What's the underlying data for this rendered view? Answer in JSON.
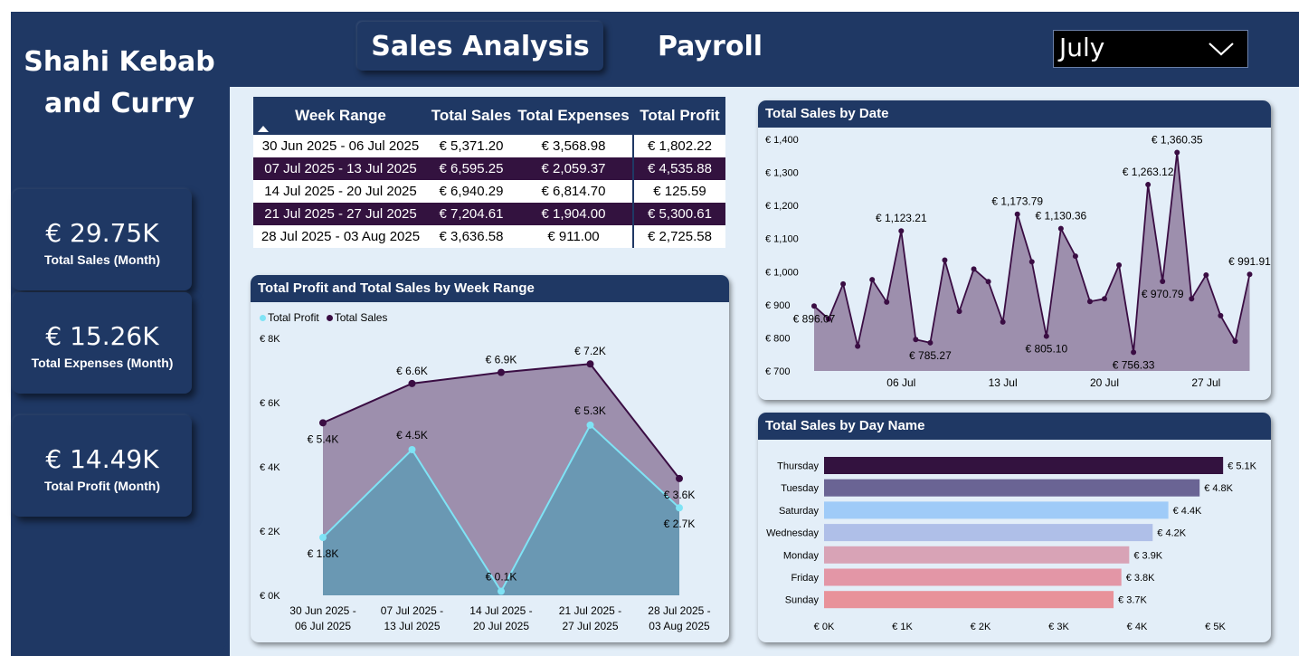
{
  "brand": {
    "line1": "Shahi Kebab",
    "line2": "and Curry"
  },
  "nav": {
    "active": "Sales Analysis",
    "inactive": "Payroll"
  },
  "month_filter": {
    "selected": "July"
  },
  "kpis": [
    {
      "value": "€ 29.75K",
      "label": "Total Sales (Month)"
    },
    {
      "value": "€ 15.26K",
      "label": "Total Expenses (Month)"
    },
    {
      "value": "€ 14.49K",
      "label": "Total Profit (Month)"
    }
  ],
  "week_table": {
    "headers": [
      "Week Range",
      "Total Sales",
      "Total Expenses",
      "Total Profit"
    ],
    "rows": [
      [
        "30 Jun 2025 - 06 Jul 2025",
        "€ 5,371.20",
        "€ 3,568.98",
        "€ 1,802.22"
      ],
      [
        "07 Jul 2025 - 13 Jul 2025",
        "€ 6,595.25",
        "€ 2,059.37",
        "€ 4,535.88"
      ],
      [
        "14 Jul 2025 - 20 Jul 2025",
        "€ 6,940.29",
        "€ 6,814.70",
        "€ 125.59"
      ],
      [
        "21 Jul 2025 - 27 Jul 2025",
        "€ 7,204.61",
        "€ 1,904.00",
        "€ 5,300.61"
      ],
      [
        "28 Jul 2025 - 03 Aug 2025",
        "€ 3,636.58",
        "€ 911.00",
        "€ 2,725.58"
      ]
    ]
  },
  "colors": {
    "navy": "#1f3864",
    "plum": "#33123f",
    "sales_line": "#3a0d43",
    "profit_line": "#7fe3f5",
    "panel_bg": "#e3eef8"
  },
  "chart_data": [
    {
      "id": "week-chart",
      "type": "area",
      "title": "Total Profit and Total Sales by Week Range",
      "categories": [
        [
          "30 Jun 2025 -",
          "06 Jul 2025"
        ],
        [
          "07 Jul 2025 -",
          "13 Jul 2025"
        ],
        [
          "14 Jul 2025 -",
          "20 Jul 2025"
        ],
        [
          "21 Jul 2025 -",
          "27 Jul 2025"
        ],
        [
          "28 Jul 2025 -",
          "03 Aug 2025"
        ]
      ],
      "series": [
        {
          "name": "Total Profit",
          "values": [
            1802.22,
            4535.88,
            125.59,
            5300.61,
            2725.58
          ],
          "labels": [
            "€ 1.8K",
            "€ 4.5K",
            "€ 0.1K",
            "€ 5.3K",
            "€ 2.7K"
          ],
          "color": "#7fe3f5"
        },
        {
          "name": "Total Sales",
          "values": [
            5371.2,
            6595.25,
            6940.29,
            7204.61,
            3636.58
          ],
          "labels": [
            "€ 5.4K",
            "€ 6.6K",
            "€ 6.9K",
            "€ 7.2K",
            "€ 3.6K"
          ],
          "color": "#3a0d43"
        }
      ],
      "ylim": [
        0,
        8000
      ],
      "yticks": [
        0,
        2000,
        4000,
        6000,
        8000
      ],
      "ytick_labels": [
        "€ 0K",
        "€ 2K",
        "€ 4K",
        "€ 6K",
        "€ 8K"
      ],
      "legend": "top-left"
    },
    {
      "id": "date-chart",
      "type": "area",
      "title": "Total Sales by Date",
      "x": [
        "2025-06-30",
        "2025-07-01",
        "2025-07-02",
        "2025-07-03",
        "2025-07-04",
        "2025-07-05",
        "2025-07-06",
        "2025-07-07",
        "2025-07-08",
        "2025-07-09",
        "2025-07-10",
        "2025-07-11",
        "2025-07-12",
        "2025-07-13",
        "2025-07-14",
        "2025-07-15",
        "2025-07-16",
        "2025-07-17",
        "2025-07-18",
        "2025-07-19",
        "2025-07-20",
        "2025-07-21",
        "2025-07-22",
        "2025-07-23",
        "2025-07-24",
        "2025-07-25",
        "2025-07-26",
        "2025-07-27",
        "2025-07-28",
        "2025-07-29",
        "2025-07-30"
      ],
      "values": [
        896.07,
        857,
        963,
        775,
        976,
        908,
        1123.21,
        795,
        785.27,
        1035,
        880,
        1008,
        970,
        848,
        1173.79,
        1030,
        805.1,
        1130.36,
        1047,
        910,
        918,
        1020,
        756.33,
        1263.12,
        970.79,
        1360.35,
        918,
        990,
        867,
        790,
        991.91
      ],
      "point_labels": [
        {
          "index": 0,
          "text": "€ 896.07",
          "pos": "below"
        },
        {
          "index": 6,
          "text": "€ 1,123.21",
          "pos": "above"
        },
        {
          "index": 8,
          "text": "€ 785.27",
          "pos": "below"
        },
        {
          "index": 14,
          "text": "€ 1,173.79",
          "pos": "above"
        },
        {
          "index": 16,
          "text": "€ 805.10",
          "pos": "below"
        },
        {
          "index": 17,
          "text": "€ 1,130.36",
          "pos": "above"
        },
        {
          "index": 22,
          "text": "€ 756.33",
          "pos": "below"
        },
        {
          "index": 23,
          "text": "€ 1,263.12",
          "pos": "above"
        },
        {
          "index": 24,
          "text": "€ 970.79",
          "pos": "below"
        },
        {
          "index": 25,
          "text": "€ 1,360.35",
          "pos": "above"
        },
        {
          "index": 30,
          "text": "€ 991.91",
          "pos": "above"
        }
      ],
      "ylim": [
        700,
        1400
      ],
      "yticks": [
        700,
        800,
        900,
        1000,
        1100,
        1200,
        1300,
        1400
      ],
      "ytick_labels": [
        "€ 700",
        "€ 800",
        "€ 900",
        "€ 1,000",
        "€ 1,100",
        "€ 1,200",
        "€ 1,300",
        "€ 1,400"
      ],
      "xticks": [
        {
          "index": 6,
          "label": "06 Jul"
        },
        {
          "index": 13,
          "label": "13 Jul"
        },
        {
          "index": 20,
          "label": "20 Jul"
        },
        {
          "index": 27,
          "label": "27 Jul"
        }
      ],
      "line_color": "#3a0d43",
      "fill_color": "#9d8fad"
    },
    {
      "id": "day-chart",
      "type": "bar",
      "orientation": "horizontal",
      "title": "Total Sales by Day Name",
      "categories": [
        "Thursday",
        "Tuesday",
        "Saturday",
        "Wednesday",
        "Monday",
        "Friday",
        "Sunday"
      ],
      "values": [
        5100,
        4800,
        4400,
        4200,
        3900,
        3800,
        3700
      ],
      "value_labels": [
        "€ 5.1K",
        "€ 4.8K",
        "€ 4.4K",
        "€ 4.2K",
        "€ 3.9K",
        "€ 3.8K",
        "€ 3.7K"
      ],
      "colors": [
        "#33123f",
        "#6a6494",
        "#9fcbf8",
        "#afbfe8",
        "#d8a3b6",
        "#e396a6",
        "#e8929a"
      ],
      "xlim": [
        0,
        5000
      ],
      "xticks": [
        0,
        1000,
        2000,
        3000,
        4000,
        5000
      ],
      "xtick_labels": [
        "€ 0K",
        "€ 1K",
        "€ 2K",
        "€ 3K",
        "€ 4K",
        "€ 5K"
      ]
    }
  ]
}
